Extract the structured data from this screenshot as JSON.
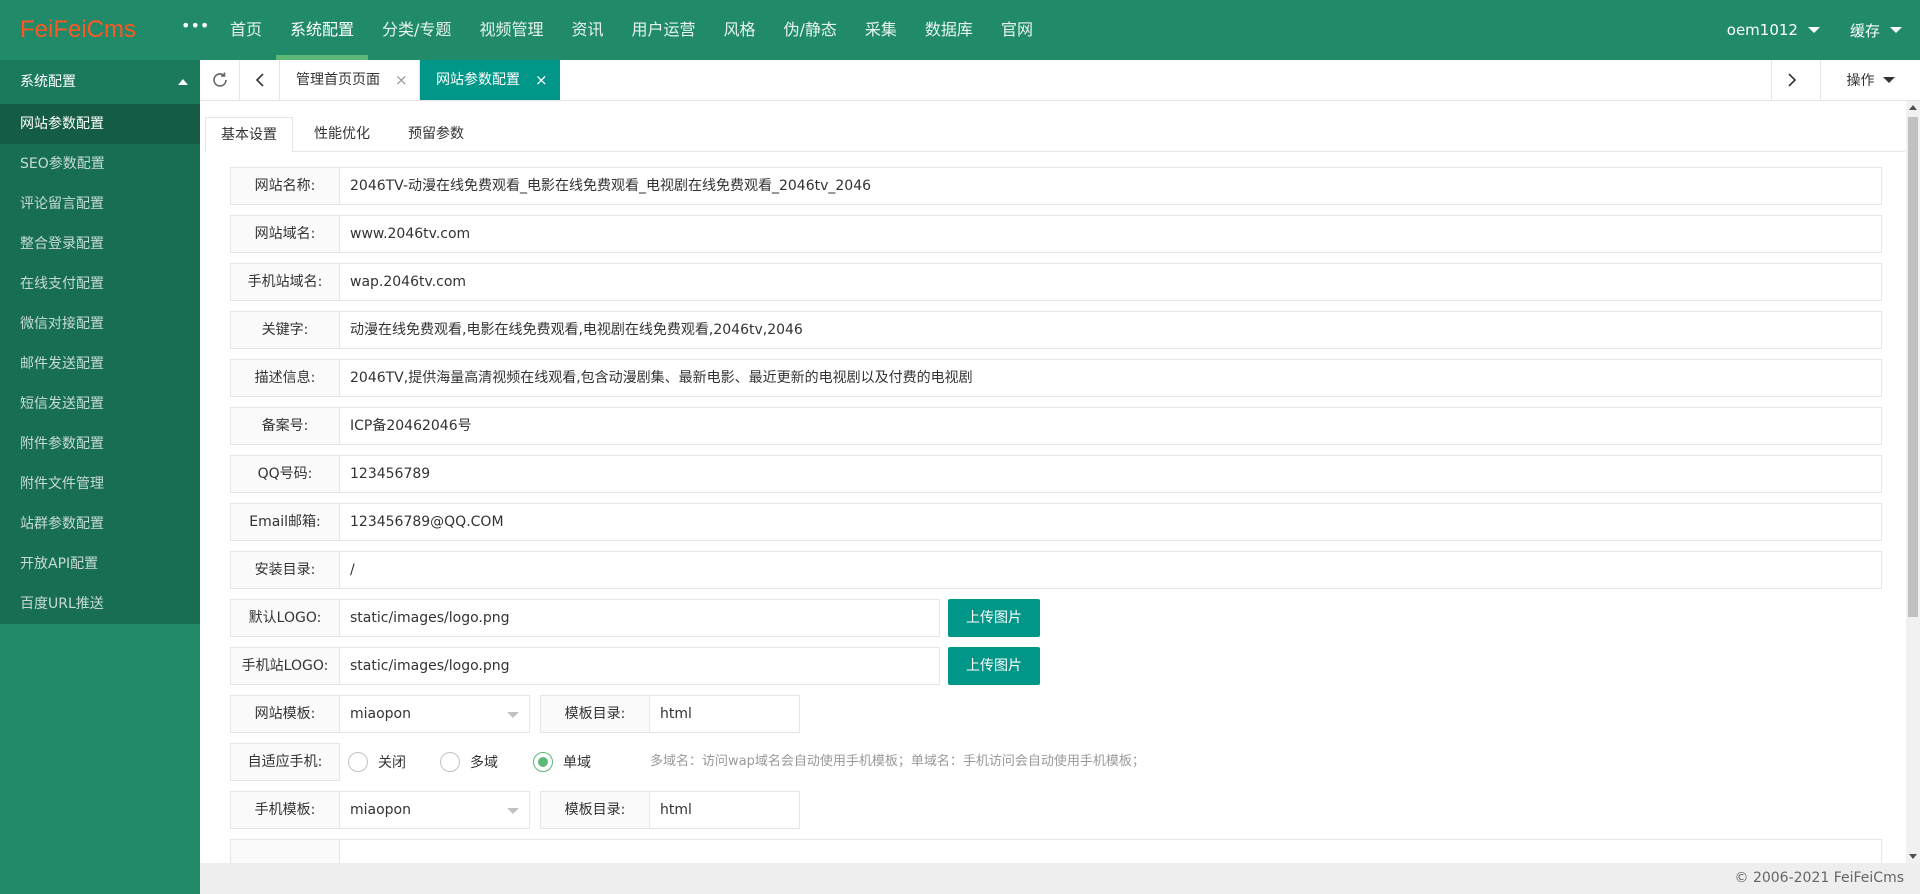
{
  "app": {
    "logo": "FeiFeiCms",
    "more": "•••"
  },
  "topnav": [
    "首页",
    "系统配置",
    "分类/专题",
    "视频管理",
    "资讯",
    "用户运营",
    "风格",
    "伪/静态",
    "采集",
    "数据库",
    "官网"
  ],
  "header_right": {
    "user": "oem1012",
    "cache": "缓存"
  },
  "sidebar": {
    "title": "系统配置",
    "items": [
      "网站参数配置",
      "SEO参数配置",
      "评论留言配置",
      "整合登录配置",
      "在线支付配置",
      "微信对接配置",
      "邮件发送配置",
      "短信发送配置",
      "附件参数配置",
      "附件文件管理",
      "站群参数配置",
      "开放API配置",
      "百度URL推送"
    ]
  },
  "tabs": [
    {
      "label": "管理首页页面",
      "close": "×"
    },
    {
      "label": "网站参数配置",
      "close": "×"
    }
  ],
  "ops": "操作",
  "subtabs": [
    "基本设置",
    "性能优化",
    "预留参数"
  ],
  "form": {
    "site_name": {
      "label": "网站名称:",
      "value": "2046TV-动漫在线免费观看_电影在线免费观看_电视剧在线免费观看_2046tv_2046"
    },
    "site_domain": {
      "label": "网站域名:",
      "value": "www.2046tv.com"
    },
    "wap_domain": {
      "label": "手机站域名:",
      "value": "wap.2046tv.com"
    },
    "keywords": {
      "label": "关键字:",
      "value": "动漫在线免费观看,电影在线免费观看,电视剧在线免费观看,2046tv,2046"
    },
    "description": {
      "label": "描述信息:",
      "value": "2046TV,提供海量高清视频在线观看,包含动漫剧集、最新电影、最近更新的电视剧以及付费的电视剧"
    },
    "icp": {
      "label": "备案号:",
      "value": " ICP备20462046号"
    },
    "qq": {
      "label": "QQ号码:",
      "value": "123456789"
    },
    "email": {
      "label": "Email邮箱:",
      "value": "123456789@QQ.COM"
    },
    "install_dir": {
      "label": "安装目录:",
      "value": "/"
    },
    "logo": {
      "label": "默认LOGO:",
      "value": "static/images/logo.png",
      "button": "上传图片"
    },
    "wap_logo": {
      "label": "手机站LOGO:",
      "value": "static/images/logo.png",
      "button": "上传图片"
    },
    "template": {
      "label": "网站模板:",
      "value": "miaopon",
      "dir_label": "模板目录:",
      "dir_value": "html"
    },
    "adaptive": {
      "label": "自适应手机:",
      "options": [
        "关闭",
        "多域",
        "单域"
      ],
      "selected": "单域",
      "hint": "多域名：访问wap域名会自动使用手机模板；单域名：手机访问会自动使用手机模板；"
    },
    "wap_template": {
      "label": "手机模板:",
      "value": "miaopon",
      "dir_label": "模板目录:",
      "dir_value": "html"
    }
  },
  "footer": "© 2006-2021 FeiFeiCms",
  "colors": {
    "primary": "#208A69",
    "accent": "#009688",
    "logo": "#ff5722"
  }
}
